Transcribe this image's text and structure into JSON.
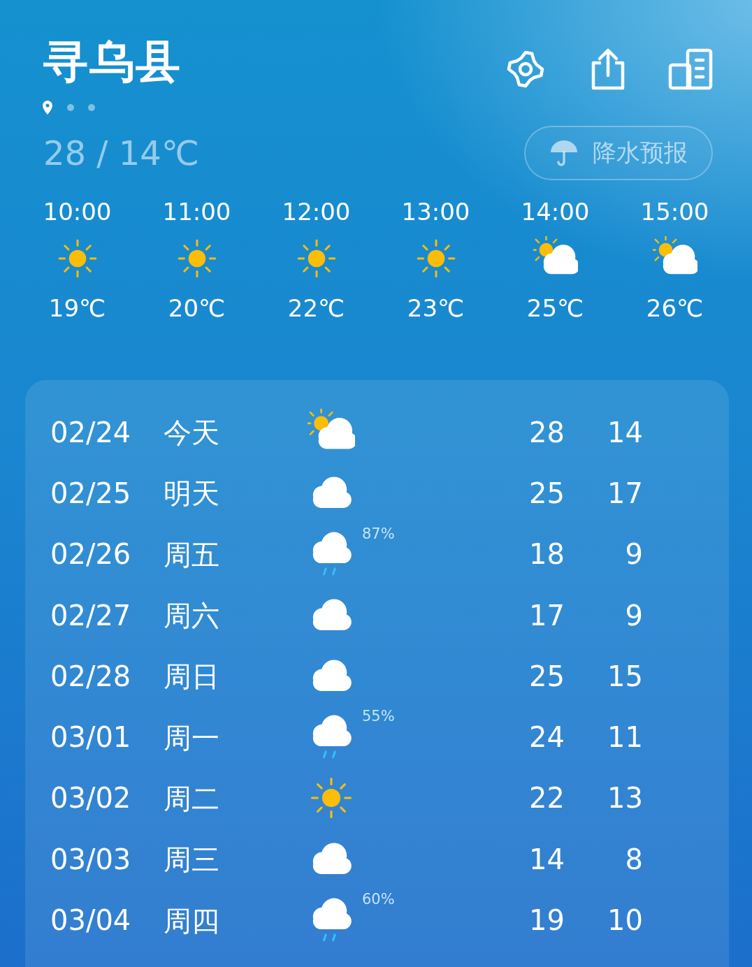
{
  "city": "寻乌县",
  "page_dots": [
    {
      "kind": "location",
      "selected": true
    },
    {
      "kind": "dot",
      "selected": false
    },
    {
      "kind": "dot",
      "selected": false
    }
  ],
  "today_range": "28 / 14℃",
  "precipitation_button": "降水预报",
  "hourly": [
    {
      "time": "10:00",
      "kind": "sunny",
      "temp": "19℃"
    },
    {
      "time": "11:00",
      "kind": "sunny",
      "temp": "20℃"
    },
    {
      "time": "12:00",
      "kind": "sunny",
      "temp": "22℃"
    },
    {
      "time": "13:00",
      "kind": "sunny",
      "temp": "23℃"
    },
    {
      "time": "14:00",
      "kind": "partly_cloudy",
      "temp": "25℃"
    },
    {
      "time": "15:00",
      "kind": "partly_cloudy",
      "temp": "26℃"
    }
  ],
  "daily": [
    {
      "date": "02/24",
      "day": "今天",
      "kind": "partly_cloudy",
      "high": "28",
      "low": "14"
    },
    {
      "date": "02/25",
      "day": "明天",
      "kind": "cloudy",
      "high": "25",
      "low": "17"
    },
    {
      "date": "02/26",
      "day": "周五",
      "kind": "rain",
      "precip": "87%",
      "high": "18",
      "low": "9"
    },
    {
      "date": "02/27",
      "day": "周六",
      "kind": "cloudy",
      "high": "17",
      "low": "9"
    },
    {
      "date": "02/28",
      "day": "周日",
      "kind": "cloudy",
      "high": "25",
      "low": "15"
    },
    {
      "date": "03/01",
      "day": "周一",
      "kind": "rain",
      "precip": "55%",
      "high": "24",
      "low": "11"
    },
    {
      "date": "03/02",
      "day": "周二",
      "kind": "sunny",
      "high": "22",
      "low": "13"
    },
    {
      "date": "03/03",
      "day": "周三",
      "kind": "cloudy",
      "high": "14",
      "low": "8"
    },
    {
      "date": "03/04",
      "day": "周四",
      "kind": "rain",
      "precip": "60%",
      "high": "19",
      "low": "10"
    }
  ]
}
